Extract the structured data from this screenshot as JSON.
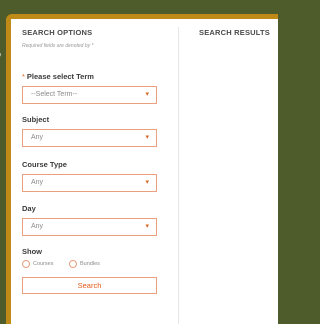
{
  "search_options": {
    "title": "SEARCH OPTIONS",
    "required_note": "Required fields are denoted by *",
    "term": {
      "required_mark": "*",
      "label": "Please select Term",
      "value": "--Select Term--"
    },
    "subject": {
      "label": "Subject",
      "value": "Any"
    },
    "course_type": {
      "label": "Course Type",
      "value": "Any"
    },
    "day": {
      "label": "Day",
      "value": "Any"
    },
    "show": {
      "label": "Show",
      "options": [
        {
          "label": "Courses"
        },
        {
          "label": "Bundles"
        }
      ]
    },
    "search_button": "Search"
  },
  "search_results": {
    "title": "SEARCH RESULTS"
  },
  "background": {
    "mark": ","
  },
  "icons": {
    "dropdown": "chevron-down-icon"
  },
  "colors": {
    "accent": "#e05a1c",
    "border": "#e9a07e",
    "frame": "#c08a16",
    "background": "#4e5b2a"
  }
}
